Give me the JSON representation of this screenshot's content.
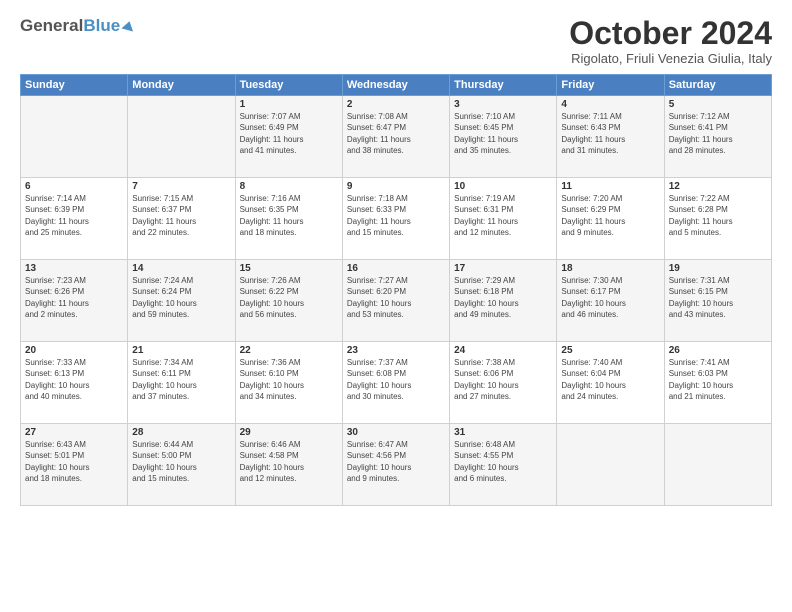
{
  "header": {
    "logo_general": "General",
    "logo_blue": "Blue",
    "title": "October 2024",
    "location": "Rigolato, Friuli Venezia Giulia, Italy"
  },
  "days_of_week": [
    "Sunday",
    "Monday",
    "Tuesday",
    "Wednesday",
    "Thursday",
    "Friday",
    "Saturday"
  ],
  "weeks": [
    [
      {
        "day": "",
        "lines": []
      },
      {
        "day": "",
        "lines": []
      },
      {
        "day": "1",
        "lines": [
          "Sunrise: 7:07 AM",
          "Sunset: 6:49 PM",
          "Daylight: 11 hours",
          "and 41 minutes."
        ]
      },
      {
        "day": "2",
        "lines": [
          "Sunrise: 7:08 AM",
          "Sunset: 6:47 PM",
          "Daylight: 11 hours",
          "and 38 minutes."
        ]
      },
      {
        "day": "3",
        "lines": [
          "Sunrise: 7:10 AM",
          "Sunset: 6:45 PM",
          "Daylight: 11 hours",
          "and 35 minutes."
        ]
      },
      {
        "day": "4",
        "lines": [
          "Sunrise: 7:11 AM",
          "Sunset: 6:43 PM",
          "Daylight: 11 hours",
          "and 31 minutes."
        ]
      },
      {
        "day": "5",
        "lines": [
          "Sunrise: 7:12 AM",
          "Sunset: 6:41 PM",
          "Daylight: 11 hours",
          "and 28 minutes."
        ]
      }
    ],
    [
      {
        "day": "6",
        "lines": [
          "Sunrise: 7:14 AM",
          "Sunset: 6:39 PM",
          "Daylight: 11 hours",
          "and 25 minutes."
        ]
      },
      {
        "day": "7",
        "lines": [
          "Sunrise: 7:15 AM",
          "Sunset: 6:37 PM",
          "Daylight: 11 hours",
          "and 22 minutes."
        ]
      },
      {
        "day": "8",
        "lines": [
          "Sunrise: 7:16 AM",
          "Sunset: 6:35 PM",
          "Daylight: 11 hours",
          "and 18 minutes."
        ]
      },
      {
        "day": "9",
        "lines": [
          "Sunrise: 7:18 AM",
          "Sunset: 6:33 PM",
          "Daylight: 11 hours",
          "and 15 minutes."
        ]
      },
      {
        "day": "10",
        "lines": [
          "Sunrise: 7:19 AM",
          "Sunset: 6:31 PM",
          "Daylight: 11 hours",
          "and 12 minutes."
        ]
      },
      {
        "day": "11",
        "lines": [
          "Sunrise: 7:20 AM",
          "Sunset: 6:29 PM",
          "Daylight: 11 hours",
          "and 9 minutes."
        ]
      },
      {
        "day": "12",
        "lines": [
          "Sunrise: 7:22 AM",
          "Sunset: 6:28 PM",
          "Daylight: 11 hours",
          "and 5 minutes."
        ]
      }
    ],
    [
      {
        "day": "13",
        "lines": [
          "Sunrise: 7:23 AM",
          "Sunset: 6:26 PM",
          "Daylight: 11 hours",
          "and 2 minutes."
        ]
      },
      {
        "day": "14",
        "lines": [
          "Sunrise: 7:24 AM",
          "Sunset: 6:24 PM",
          "Daylight: 10 hours",
          "and 59 minutes."
        ]
      },
      {
        "day": "15",
        "lines": [
          "Sunrise: 7:26 AM",
          "Sunset: 6:22 PM",
          "Daylight: 10 hours",
          "and 56 minutes."
        ]
      },
      {
        "day": "16",
        "lines": [
          "Sunrise: 7:27 AM",
          "Sunset: 6:20 PM",
          "Daylight: 10 hours",
          "and 53 minutes."
        ]
      },
      {
        "day": "17",
        "lines": [
          "Sunrise: 7:29 AM",
          "Sunset: 6:18 PM",
          "Daylight: 10 hours",
          "and 49 minutes."
        ]
      },
      {
        "day": "18",
        "lines": [
          "Sunrise: 7:30 AM",
          "Sunset: 6:17 PM",
          "Daylight: 10 hours",
          "and 46 minutes."
        ]
      },
      {
        "day": "19",
        "lines": [
          "Sunrise: 7:31 AM",
          "Sunset: 6:15 PM",
          "Daylight: 10 hours",
          "and 43 minutes."
        ]
      }
    ],
    [
      {
        "day": "20",
        "lines": [
          "Sunrise: 7:33 AM",
          "Sunset: 6:13 PM",
          "Daylight: 10 hours",
          "and 40 minutes."
        ]
      },
      {
        "day": "21",
        "lines": [
          "Sunrise: 7:34 AM",
          "Sunset: 6:11 PM",
          "Daylight: 10 hours",
          "and 37 minutes."
        ]
      },
      {
        "day": "22",
        "lines": [
          "Sunrise: 7:36 AM",
          "Sunset: 6:10 PM",
          "Daylight: 10 hours",
          "and 34 minutes."
        ]
      },
      {
        "day": "23",
        "lines": [
          "Sunrise: 7:37 AM",
          "Sunset: 6:08 PM",
          "Daylight: 10 hours",
          "and 30 minutes."
        ]
      },
      {
        "day": "24",
        "lines": [
          "Sunrise: 7:38 AM",
          "Sunset: 6:06 PM",
          "Daylight: 10 hours",
          "and 27 minutes."
        ]
      },
      {
        "day": "25",
        "lines": [
          "Sunrise: 7:40 AM",
          "Sunset: 6:04 PM",
          "Daylight: 10 hours",
          "and 24 minutes."
        ]
      },
      {
        "day": "26",
        "lines": [
          "Sunrise: 7:41 AM",
          "Sunset: 6:03 PM",
          "Daylight: 10 hours",
          "and 21 minutes."
        ]
      }
    ],
    [
      {
        "day": "27",
        "lines": [
          "Sunrise: 6:43 AM",
          "Sunset: 5:01 PM",
          "Daylight: 10 hours",
          "and 18 minutes."
        ]
      },
      {
        "day": "28",
        "lines": [
          "Sunrise: 6:44 AM",
          "Sunset: 5:00 PM",
          "Daylight: 10 hours",
          "and 15 minutes."
        ]
      },
      {
        "day": "29",
        "lines": [
          "Sunrise: 6:46 AM",
          "Sunset: 4:58 PM",
          "Daylight: 10 hours",
          "and 12 minutes."
        ]
      },
      {
        "day": "30",
        "lines": [
          "Sunrise: 6:47 AM",
          "Sunset: 4:56 PM",
          "Daylight: 10 hours",
          "and 9 minutes."
        ]
      },
      {
        "day": "31",
        "lines": [
          "Sunrise: 6:48 AM",
          "Sunset: 4:55 PM",
          "Daylight: 10 hours",
          "and 6 minutes."
        ]
      },
      {
        "day": "",
        "lines": []
      },
      {
        "day": "",
        "lines": []
      }
    ]
  ]
}
